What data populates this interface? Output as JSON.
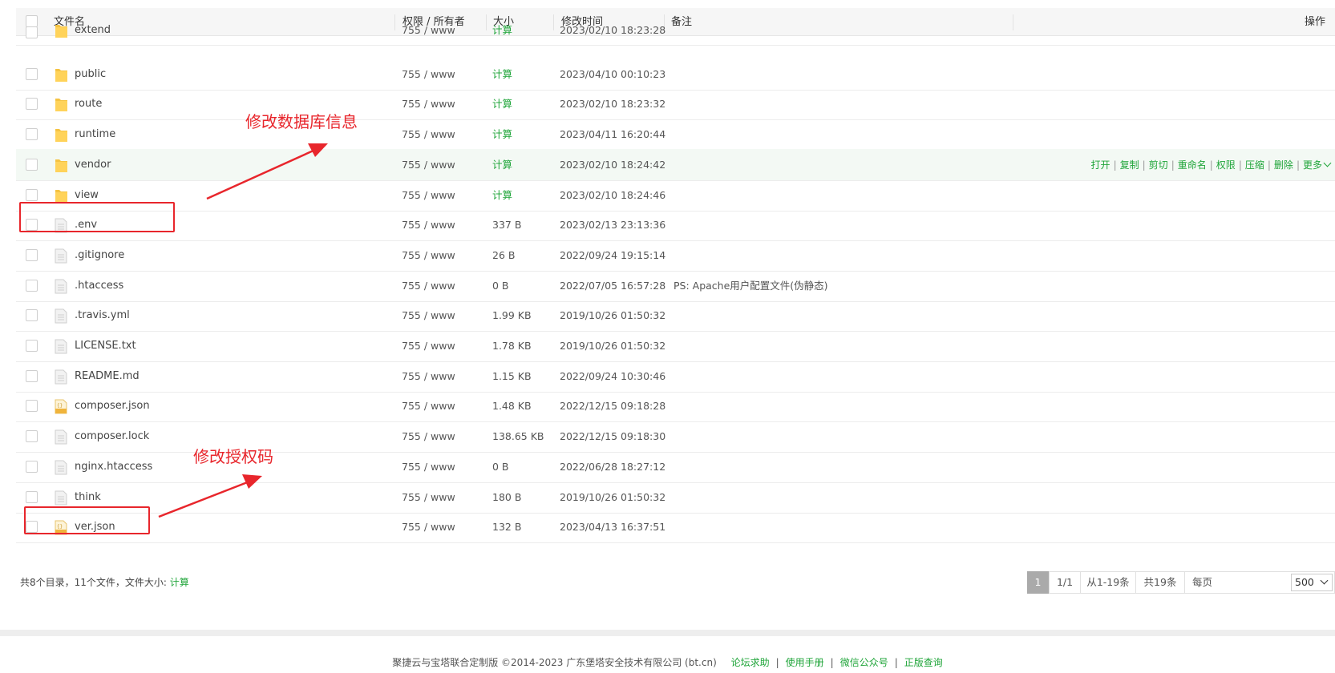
{
  "header": {
    "col_name": "文件名",
    "col_perm": "权限 / 所有者",
    "col_size": "大小",
    "col_mtime": "修改时间",
    "col_note": "备注",
    "col_ops": "操作"
  },
  "rows": [
    {
      "name": "extend",
      "type": "folder",
      "perm": "755 / www",
      "size": "计算",
      "mtime": "2023/02/10 18:23:28",
      "note": ""
    },
    {
      "name": "public",
      "type": "folder",
      "perm": "755 / www",
      "size": "计算",
      "mtime": "2023/04/10 00:10:23",
      "note": ""
    },
    {
      "name": "route",
      "type": "folder",
      "perm": "755 / www",
      "size": "计算",
      "mtime": "2023/02/10 18:23:32",
      "note": ""
    },
    {
      "name": "runtime",
      "type": "folder",
      "perm": "755 / www",
      "size": "计算",
      "mtime": "2023/04/11 16:20:44",
      "note": ""
    },
    {
      "name": "vendor",
      "type": "folder",
      "perm": "755 / www",
      "size": "计算",
      "mtime": "2023/02/10 18:24:42",
      "note": ""
    },
    {
      "name": "view",
      "type": "folder",
      "perm": "755 / www",
      "size": "计算",
      "mtime": "2023/02/10 18:24:46",
      "note": ""
    },
    {
      "name": ".env",
      "type": "file",
      "perm": "755 / www",
      "size": "337 B",
      "mtime": "2023/02/13 23:13:36",
      "note": ""
    },
    {
      "name": ".gitignore",
      "type": "file",
      "perm": "755 / www",
      "size": "26 B",
      "mtime": "2022/09/24 19:15:14",
      "note": ""
    },
    {
      "name": ".htaccess",
      "type": "file",
      "perm": "755 / www",
      "size": "0 B",
      "mtime": "2022/07/05 16:57:28",
      "note": "PS: Apache用户配置文件(伪静态)"
    },
    {
      "name": ".travis.yml",
      "type": "file",
      "perm": "755 / www",
      "size": "1.99 KB",
      "mtime": "2019/10/26 01:50:32",
      "note": ""
    },
    {
      "name": "LICENSE.txt",
      "type": "file",
      "perm": "755 / www",
      "size": "1.78 KB",
      "mtime": "2019/10/26 01:50:32",
      "note": ""
    },
    {
      "name": "README.md",
      "type": "file",
      "perm": "755 / www",
      "size": "1.15 KB",
      "mtime": "2022/09/24 10:30:46",
      "note": ""
    },
    {
      "name": "composer.json",
      "type": "json",
      "perm": "755 / www",
      "size": "1.48 KB",
      "mtime": "2022/12/15 09:18:28",
      "note": ""
    },
    {
      "name": "composer.lock",
      "type": "file",
      "perm": "755 / www",
      "size": "138.65 KB",
      "mtime": "2022/12/15 09:18:30",
      "note": ""
    },
    {
      "name": "nginx.htaccess",
      "type": "file",
      "perm": "755 / www",
      "size": "0 B",
      "mtime": "2022/06/28 18:27:12",
      "note": ""
    },
    {
      "name": "think",
      "type": "file",
      "perm": "755 / www",
      "size": "180 B",
      "mtime": "2019/10/26 01:50:32",
      "note": ""
    },
    {
      "name": "ver.json",
      "type": "json",
      "perm": "755 / www",
      "size": "132 B",
      "mtime": "2023/04/13 16:37:51",
      "note": ""
    }
  ],
  "hover_row_index": 4,
  "row_ops": [
    "打开",
    "复制",
    "剪切",
    "重命名",
    "权限",
    "压缩",
    "删除",
    "更多"
  ],
  "summary": {
    "text": "共8个目录，11个文件，文件大小:",
    "calc_link": "计算"
  },
  "pagination": {
    "current_page": "1",
    "page_of": "1/1",
    "range": "从1-19条",
    "total": "共19条",
    "per_page_label": "每页",
    "per_page_value": "500"
  },
  "footer": {
    "copyright": "聚捷云与宝塔联合定制版 ©2014-2023 广东堡塔安全技术有限公司 (bt.cn)",
    "links": [
      "论坛求助",
      "使用手册",
      "微信公众号",
      "正版查询"
    ]
  },
  "annotations": {
    "db_note": "修改数据库信息",
    "auth_note": "修改授权码"
  },
  "colors": {
    "accent_green": "#20a53a",
    "annotation_red": "#e8262c",
    "folder_yellow": "#f5c342"
  }
}
